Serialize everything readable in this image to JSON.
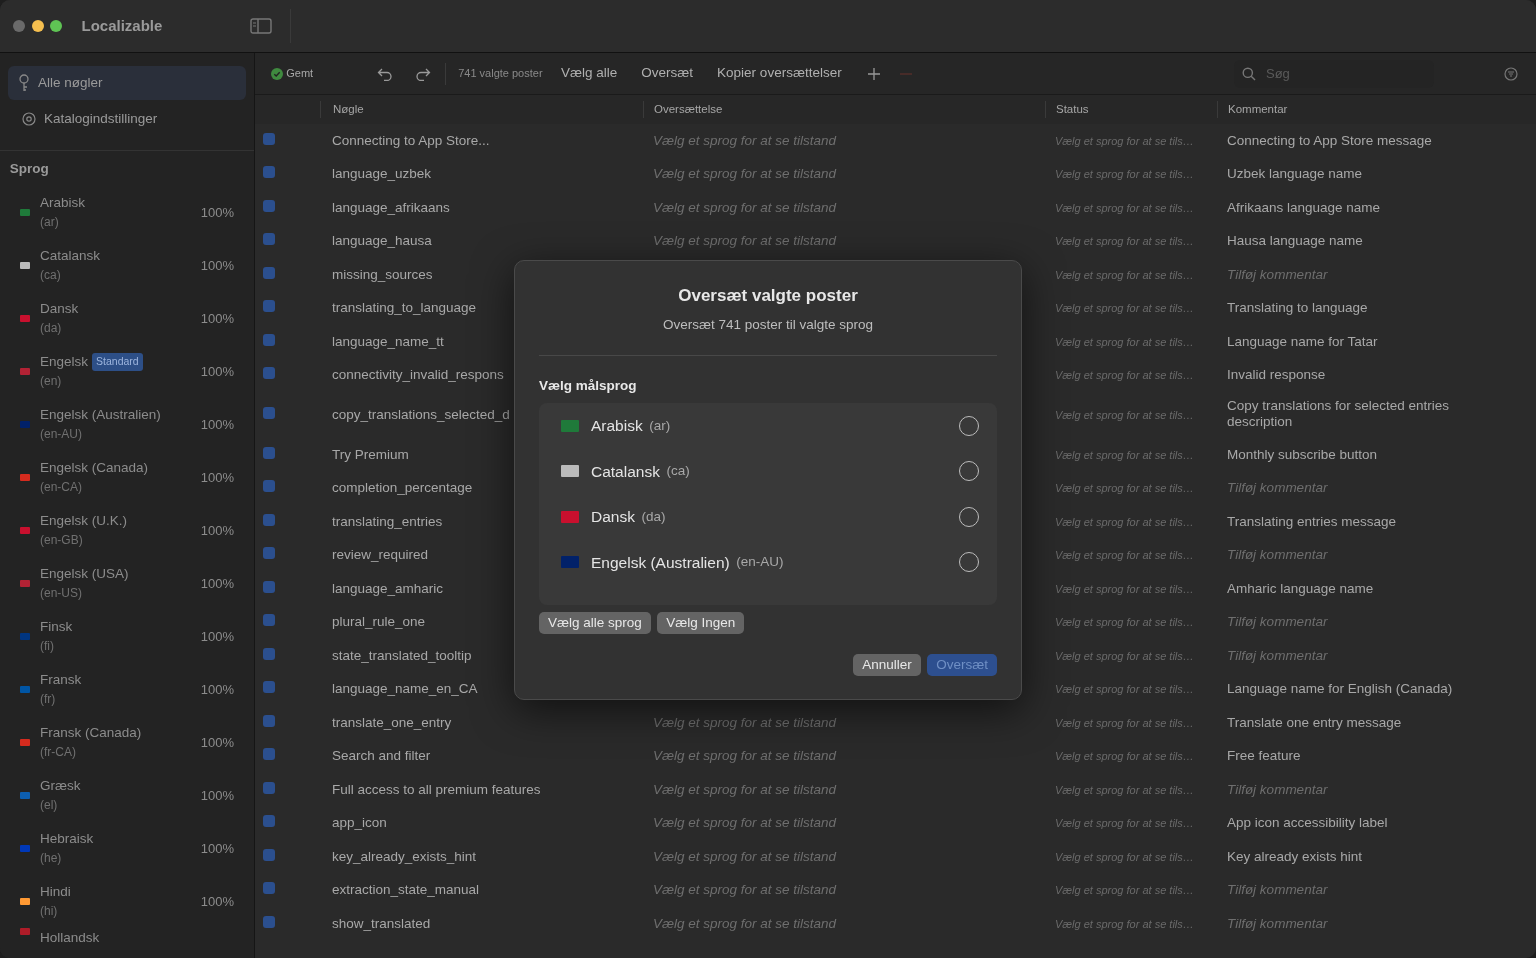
{
  "window": {
    "title": "Localizable"
  },
  "sidebar": {
    "items": [
      {
        "label": "Alle nøgler",
        "kind": "key",
        "selected": true
      },
      {
        "label": "Katalogindstillinger",
        "kind": "gear",
        "selected": false
      }
    ],
    "section_title": "Sprog",
    "languages": [
      {
        "name": "Arabisk",
        "code": "(ar)",
        "percent": "100%",
        "color": "#1f7a3a"
      },
      {
        "name": "Catalansk",
        "code": "(ca)",
        "percent": "100%",
        "color": "#bbbbbb"
      },
      {
        "name": "Dansk",
        "code": "(da)",
        "percent": "100%",
        "color": "#c8102e"
      },
      {
        "name": "Engelsk",
        "badge": "Standard",
        "code": "(en)",
        "percent": "100%",
        "color": "#b22234"
      },
      {
        "name": "Engelsk (Australien)",
        "code": "(en-AU)",
        "percent": "100%",
        "color": "#012169"
      },
      {
        "name": "Engelsk (Canada)",
        "code": "(en-CA)",
        "percent": "100%",
        "color": "#d52b1e"
      },
      {
        "name": "Engelsk (U.K.)",
        "code": "(en-GB)",
        "percent": "100%",
        "color": "#c8102e"
      },
      {
        "name": "Engelsk (USA)",
        "code": "(en-US)",
        "percent": "100%",
        "color": "#b22234"
      },
      {
        "name": "Finsk",
        "code": "(fi)",
        "percent": "100%",
        "color": "#003580"
      },
      {
        "name": "Fransk",
        "code": "(fr)",
        "percent": "100%",
        "color": "#0055a4"
      },
      {
        "name": "Fransk (Canada)",
        "code": "(fr-CA)",
        "percent": "100%",
        "color": "#d52b1e"
      },
      {
        "name": "Græsk",
        "code": "(el)",
        "percent": "100%",
        "color": "#0d5eaf"
      },
      {
        "name": "Hebraisk",
        "code": "(he)",
        "percent": "100%",
        "color": "#0038b8"
      },
      {
        "name": "Hindi",
        "code": "(hi)",
        "percent": "100%",
        "color": "#ff9933"
      },
      {
        "name": "Hollandsk",
        "color": "#ae1c28"
      }
    ]
  },
  "toolbar": {
    "save_status": "Gemt",
    "selection_count": "741 valgte poster",
    "actions": [
      "Vælg alle",
      "Oversæt",
      "Kopier oversættelser"
    ],
    "add_disabled": false,
    "remove_disabled": true,
    "search": {
      "placeholder": "Søg"
    }
  },
  "table": {
    "columns": [
      "Nøgle",
      "Oversættelse",
      "Status",
      "Kommentar"
    ],
    "rows": [
      {
        "checked": true,
        "key": "Connecting to App Store...",
        "translation_placeholder": "Vælg et sprog for at se tilstand",
        "status": "Vælg et sprog for at se tils…",
        "comment": "Connecting to App Store message"
      },
      {
        "checked": true,
        "key": "language_uzbek",
        "translation_placeholder": "Vælg et sprog for at se tilstand",
        "status": "Vælg et sprog for at se tils…",
        "comment": "Uzbek language name"
      },
      {
        "checked": true,
        "key": "language_afrikaans",
        "translation_placeholder": "Vælg et sprog for at se tilstand",
        "status": "Vælg et sprog for at se tils…",
        "comment": "Afrikaans language name"
      },
      {
        "checked": true,
        "key": "language_hausa",
        "translation_placeholder": "Vælg et sprog for at se tilstand",
        "status": "Vælg et sprog for at se tils…",
        "comment": "Hausa language name"
      },
      {
        "checked": true,
        "key": "missing_sources",
        "status": "Vælg et sprog for at se tils…",
        "comment_placeholder": "Tilføj kommentar"
      },
      {
        "checked": true,
        "key": "translating_to_language",
        "status": "Vælg et sprog for at se tils…",
        "comment": "Translating to language"
      },
      {
        "checked": true,
        "key": "language_name_tt",
        "status": "Vælg et sprog for at se tils…",
        "comment": "Language name for Tatar"
      },
      {
        "checked": true,
        "key": "connectivity_invalid_respons",
        "status": "Vælg et sprog for at se tils…",
        "comment": "Invalid response"
      },
      {
        "checked": true,
        "key": "copy_translations_selected_d",
        "status": "Vælg et sprog for at se tils…",
        "comment": "Copy translations for selected entries description"
      },
      {
        "checked": true,
        "key": "Try Premium",
        "status": "Vælg et sprog for at se tils…",
        "comment": "Monthly subscribe button"
      },
      {
        "checked": true,
        "key": "completion_percentage",
        "status": "Vælg et sprog for at se tils…",
        "comment_placeholder": "Tilføj kommentar"
      },
      {
        "checked": true,
        "key": "translating_entries",
        "status": "Vælg et sprog for at se tils…",
        "comment": "Translating entries message"
      },
      {
        "checked": true,
        "key": "review_required",
        "status": "Vælg et sprog for at se tils…",
        "comment_placeholder": "Tilføj kommentar"
      },
      {
        "checked": true,
        "key": "language_amharic",
        "status": "Vælg et sprog for at se tils…",
        "comment": "Amharic language name"
      },
      {
        "checked": true,
        "key": "plural_rule_one",
        "status": "Vælg et sprog for at se tils…",
        "comment_placeholder": "Tilføj kommentar"
      },
      {
        "checked": true,
        "key": "state_translated_tooltip",
        "status": "Vælg et sprog for at se tils…",
        "comment_placeholder": "Tilføj kommentar"
      },
      {
        "checked": true,
        "key": "language_name_en_CA",
        "status": "Vælg et sprog for at se tils…",
        "comment": "Language name for English (Canada)"
      },
      {
        "checked": true,
        "key": "translate_one_entry",
        "translation_placeholder": "Vælg et sprog for at se tilstand",
        "status": "Vælg et sprog for at se tils…",
        "comment": "Translate one entry message"
      },
      {
        "checked": true,
        "key": "Search and filter",
        "translation_placeholder": "Vælg et sprog for at se tilstand",
        "status": "Vælg et sprog for at se tils…",
        "comment": "Free feature"
      },
      {
        "checked": true,
        "key": "Full access to all premium features",
        "translation_placeholder": "Vælg et sprog for at se tilstand",
        "status": "Vælg et sprog for at se tils…",
        "comment_placeholder": "Tilføj kommentar"
      },
      {
        "checked": true,
        "key": "app_icon",
        "translation_placeholder": "Vælg et sprog for at se tilstand",
        "status": "Vælg et sprog for at se tils…",
        "comment": "App icon accessibility label"
      },
      {
        "checked": true,
        "key": "key_already_exists_hint",
        "translation_placeholder": "Vælg et sprog for at se tilstand",
        "status": "Vælg et sprog for at se tils…",
        "comment": "Key already exists hint"
      },
      {
        "checked": true,
        "key": "extraction_state_manual",
        "translation_placeholder": "Vælg et sprog for at se tilstand",
        "status": "Vælg et sprog for at se tils…",
        "comment_placeholder": "Tilføj kommentar"
      },
      {
        "checked": true,
        "key": "show_translated",
        "translation_placeholder": "Vælg et sprog for at se tilstand",
        "status": "Vælg et sprog for at se tils…",
        "comment_placeholder": "Tilføj kommentar"
      }
    ]
  },
  "dialog": {
    "title": "Oversæt valgte poster",
    "subtitle": "Oversæt 741 poster til valgte sprog",
    "section_title": "Vælg målsprog",
    "languages": [
      {
        "name": "Arabisk",
        "code": "(ar)",
        "color": "#1f7a3a",
        "selected": false
      },
      {
        "name": "Catalansk",
        "code": "(ca)",
        "color": "#bbbbbb",
        "selected": false
      },
      {
        "name": "Dansk",
        "code": "(da)",
        "color": "#c8102e",
        "selected": false
      },
      {
        "name": "Engelsk (Australien)",
        "code": "(en-AU)",
        "color": "#012169",
        "selected": false
      }
    ],
    "select_buttons": [
      "Vælg alle sprog",
      "Vælg Ingen"
    ],
    "cancel": "Annuller",
    "confirm": "Oversæt",
    "confirm_disabled": true
  }
}
